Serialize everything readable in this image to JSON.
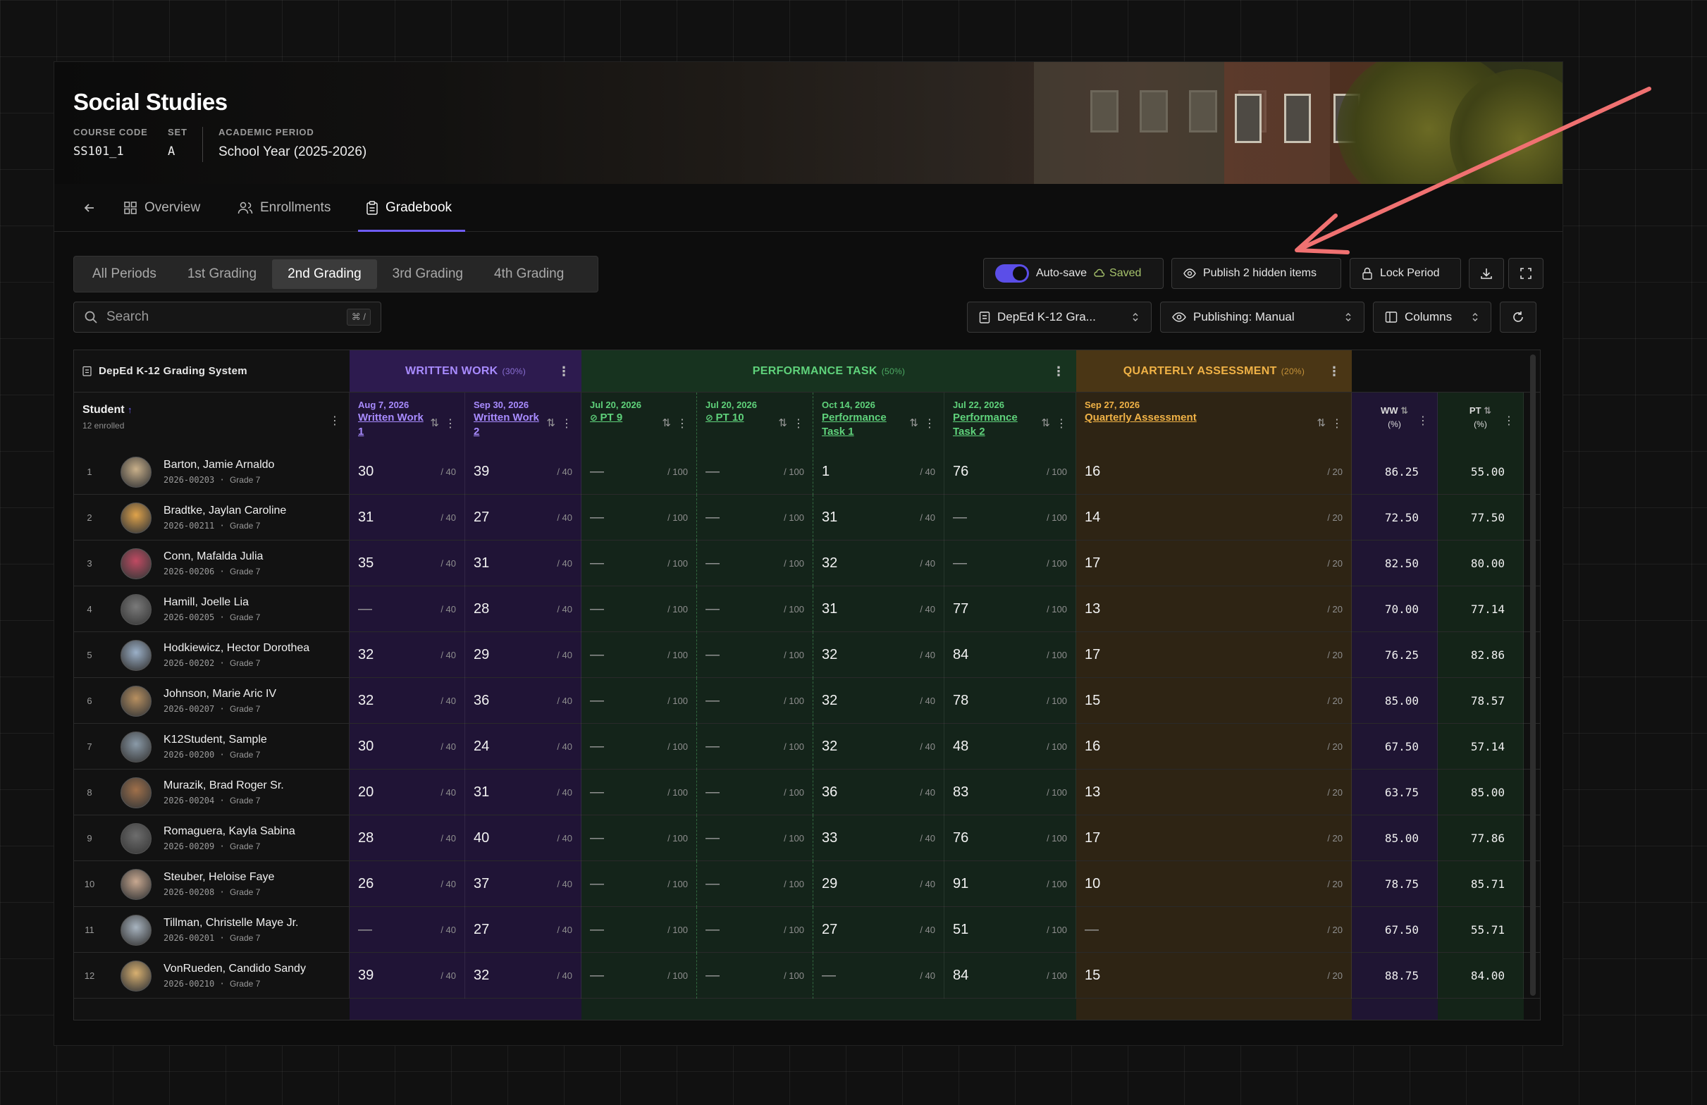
{
  "course": {
    "title": "Social Studies",
    "code_label": "COURSE CODE",
    "code": "SS101_1",
    "set_label": "SET",
    "set": "A",
    "period_label": "ACADEMIC PERIOD",
    "period": "School Year (2025-2026)"
  },
  "nav": {
    "tabs": [
      {
        "label": "Overview",
        "icon": "grid-icon"
      },
      {
        "label": "Enrollments",
        "icon": "users-icon"
      },
      {
        "label": "Gradebook",
        "icon": "clipboard-icon"
      }
    ],
    "active": "Gradebook"
  },
  "periods": [
    "All Periods",
    "1st Grading",
    "2nd Grading",
    "3rd Grading",
    "4th Grading"
  ],
  "active_period": "2nd Grading",
  "search": {
    "placeholder": "Search",
    "shortcut": "⌘ /"
  },
  "toolbar": {
    "autosave_label": "Auto-save",
    "saved_label": "Saved",
    "publish_label": "Publish 2 hidden items",
    "lock_label": "Lock Period",
    "grading_system_select": "DepEd K-12 Gra...",
    "publishing_select": "Publishing: Manual",
    "columns_label": "Columns"
  },
  "colors": {
    "accent": "#5b4ee8",
    "written_work": "#8b6cf0",
    "performance_task": "#4fc36a",
    "quarterly": "#e8a33d"
  },
  "table": {
    "system_label": "DepEd K-12 Grading System",
    "student_header": "Student",
    "enrolled": "12 enrolled",
    "groups": [
      {
        "name": "WRITTEN WORK",
        "pct": "(30%)"
      },
      {
        "name": "PERFORMANCE TASK",
        "pct": "(50%)"
      },
      {
        "name": "QUARTERLY ASSESSMENT",
        "pct": "(20%)"
      }
    ],
    "columns": [
      {
        "date": "Aug 7, 2026",
        "title": "Written Work 1"
      },
      {
        "date": "Sep 30, 2026",
        "title": "Written Work 2"
      },
      {
        "date": "Jul 20, 2026",
        "title": "PT 9"
      },
      {
        "date": "Jul 20, 2026",
        "title": "PT 10"
      },
      {
        "date": "Oct 14, 2026",
        "title": "Performance Task 1"
      },
      {
        "date": "Jul 22, 2026",
        "title": "Performance Task 2"
      },
      {
        "date": "Sep 27, 2026",
        "title": "Quarterly Assessment"
      }
    ],
    "max": [
      "/ 40",
      "/ 40",
      "/ 100",
      "/ 100",
      "/ 40",
      "/ 100",
      "/ 20"
    ],
    "pct_headers": [
      {
        "top": "WW",
        "bottom": "(%)"
      },
      {
        "top": "PT",
        "bottom": "(%)"
      }
    ],
    "rows": [
      {
        "num": "1",
        "name": "Barton, Jamie Arnaldo",
        "id": "2026-00203",
        "grade": "Grade 7",
        "scores": [
          "30",
          "39",
          "—",
          "—",
          "1",
          "76",
          "16"
        ],
        "ww": "86.25",
        "pt": "55.00"
      },
      {
        "num": "2",
        "name": "Bradtke, Jaylan Caroline",
        "id": "2026-00211",
        "grade": "Grade 7",
        "scores": [
          "31",
          "27",
          "—",
          "—",
          "31",
          "—",
          "14"
        ],
        "ww": "72.50",
        "pt": "77.50"
      },
      {
        "num": "3",
        "name": "Conn, Mafalda Julia",
        "id": "2026-00206",
        "grade": "Grade 7",
        "scores": [
          "35",
          "31",
          "—",
          "—",
          "32",
          "—",
          "17"
        ],
        "ww": "82.50",
        "pt": "80.00"
      },
      {
        "num": "4",
        "name": "Hamill, Joelle Lia",
        "id": "2026-00205",
        "grade": "Grade 7",
        "scores": [
          "—",
          "28",
          "—",
          "—",
          "31",
          "77",
          "13"
        ],
        "ww": "70.00",
        "pt": "77.14"
      },
      {
        "num": "5",
        "name": "Hodkiewicz, Hector Dorothea",
        "id": "2026-00202",
        "grade": "Grade 7",
        "scores": [
          "32",
          "29",
          "—",
          "—",
          "32",
          "84",
          "17"
        ],
        "ww": "76.25",
        "pt": "82.86"
      },
      {
        "num": "6",
        "name": "Johnson, Marie Aric IV",
        "id": "2026-00207",
        "grade": "Grade 7",
        "scores": [
          "32",
          "36",
          "—",
          "—",
          "32",
          "78",
          "15"
        ],
        "ww": "85.00",
        "pt": "78.57"
      },
      {
        "num": "7",
        "name": "K12Student, Sample",
        "id": "2026-00200",
        "grade": "Grade 7",
        "scores": [
          "30",
          "24",
          "—",
          "—",
          "32",
          "48",
          "16"
        ],
        "ww": "67.50",
        "pt": "57.14"
      },
      {
        "num": "8",
        "name": "Murazik, Brad Roger Sr.",
        "id": "2026-00204",
        "grade": "Grade 7",
        "scores": [
          "20",
          "31",
          "—",
          "—",
          "36",
          "83",
          "13"
        ],
        "ww": "63.75",
        "pt": "85.00"
      },
      {
        "num": "9",
        "name": "Romaguera, Kayla Sabina",
        "id": "2026-00209",
        "grade": "Grade 7",
        "scores": [
          "28",
          "40",
          "—",
          "—",
          "33",
          "76",
          "17"
        ],
        "ww": "85.00",
        "pt": "77.86"
      },
      {
        "num": "10",
        "name": "Steuber, Heloise Faye",
        "id": "2026-00208",
        "grade": "Grade 7",
        "scores": [
          "26",
          "37",
          "—",
          "—",
          "29",
          "91",
          "10"
        ],
        "ww": "78.75",
        "pt": "85.71"
      },
      {
        "num": "11",
        "name": "Tillman, Christelle Maye Jr.",
        "id": "2026-00201",
        "grade": "Grade 7",
        "scores": [
          "—",
          "27",
          "—",
          "—",
          "27",
          "51",
          "—"
        ],
        "ww": "67.50",
        "pt": "55.71"
      },
      {
        "num": "12",
        "name": "VonRueden, Candido Sandy",
        "id": "2026-00210",
        "grade": "Grade 7",
        "scores": [
          "39",
          "32",
          "—",
          "—",
          "—",
          "84",
          "15"
        ],
        "ww": "88.75",
        "pt": "84.00"
      }
    ]
  }
}
